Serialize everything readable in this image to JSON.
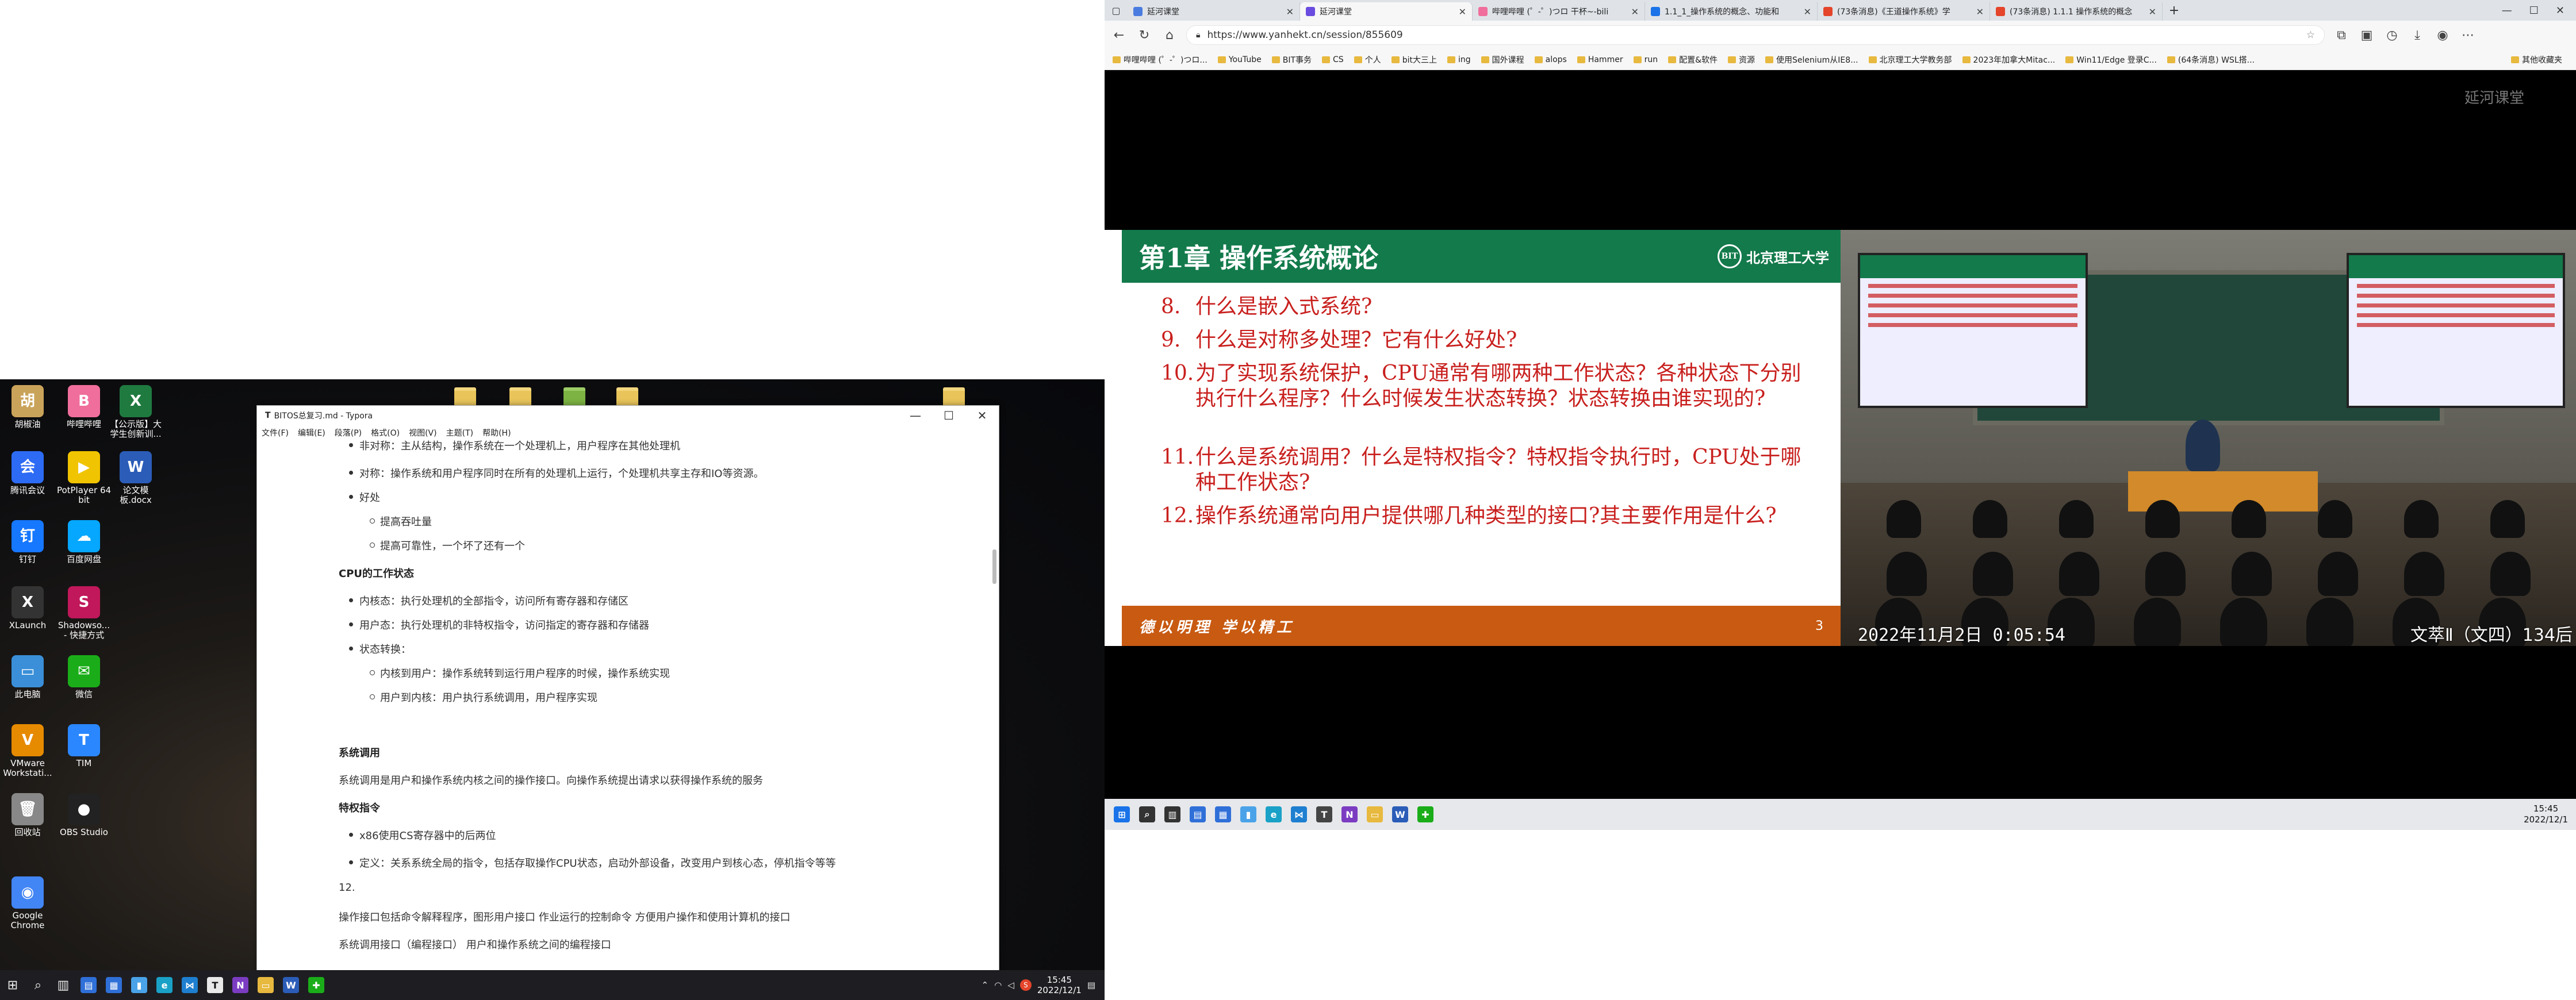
{
  "left_desktop": {
    "icons": [
      {
        "label": "胡椒油",
        "color": "#caa35a",
        "glyph": "胡"
      },
      {
        "label": "哔哩哔哩",
        "color": "#f06e9b",
        "glyph": "B"
      },
      {
        "label": "【公示版】大学生创新训...",
        "color": "#1f7a40",
        "glyph": "X"
      },
      {
        "label": "腾讯会议",
        "color": "#2d6bf5",
        "glyph": "会"
      },
      {
        "label": "PotPlayer 64 bit",
        "color": "#f0c400",
        "glyph": "▶"
      },
      {
        "label": "论文模板.docx",
        "color": "#2b5db8",
        "glyph": "W"
      },
      {
        "label": "钉钉",
        "color": "#1677ff",
        "glyph": "钉"
      },
      {
        "label": "百度网盘",
        "color": "#06a7ff",
        "glyph": "☁"
      },
      {
        "label": "XLaunch",
        "color": "#333",
        "glyph": "X"
      },
      {
        "label": "Shadowso... - 快捷方式",
        "color": "#c0185a",
        "glyph": "S"
      },
      {
        "label": "此电脑",
        "color": "#3a8fd8",
        "glyph": "▭"
      },
      {
        "label": "微信",
        "color": "#1aad19",
        "glyph": "✉"
      },
      {
        "label": "VMware Workstati...",
        "color": "#e68a00",
        "glyph": "V"
      },
      {
        "label": "TIM",
        "color": "#2b87ff",
        "glyph": "T"
      },
      {
        "label": "回收站",
        "color": "#888",
        "glyph": "🗑"
      },
      {
        "label": "OBS Studio",
        "color": "#222",
        "glyph": "●"
      },
      {
        "label": "Google Chrome",
        "color": "#4285f4",
        "glyph": "◉"
      }
    ]
  },
  "typora": {
    "title": "BITOS总复习.md - Typora",
    "menu": [
      "文件(F)",
      "编辑(E)",
      "段落(P)",
      "格式(O)",
      "视图(V)",
      "主题(T)",
      "帮助(H)"
    ],
    "lines": [
      {
        "text": "非对称：主从结构，操作系统在一个处理机上，用户程序在其他处理机",
        "style": "b1",
        "x": 1
      },
      {
        "text": "对称：操作系统和用户程序同时在所有的处理机上运行，个处理机共享主存和IO等资源。",
        "style": "b1",
        "x": 1
      },
      {
        "text": "好处",
        "style": "b1",
        "x": 1
      },
      {
        "text": "提高吞吐量",
        "style": "b2",
        "x": 2
      },
      {
        "text": "提高可靠性，一个坏了还有一个",
        "style": "b2",
        "x": 2
      },
      {
        "text": "CPU的工作状态",
        "style": "h",
        "x": 0
      },
      {
        "text": "内核态：执行处理机的全部指令，访问所有寄存器和存储区",
        "style": "b1",
        "x": 1
      },
      {
        "text": "用户态：执行处理机的非特权指令，访问指定的寄存器和存储器",
        "style": "b1",
        "x": 1
      },
      {
        "text": "状态转换：",
        "style": "b1",
        "x": 1
      },
      {
        "text": "内核到用户：操作系统转到运行用户程序的时候，操作系统实现",
        "style": "b2",
        "x": 2
      },
      {
        "text": "用户到内核：用户执行系统调用，用户程序实现",
        "style": "b2",
        "x": 2
      },
      {
        "text": "系统调用",
        "style": "h",
        "x": 0
      },
      {
        "text": "系统调用是用户和操作系统内核之间的操作接口。向操作系统提出请求以获得操作系统的服务",
        "style": "p",
        "x": 0
      },
      {
        "text": "特权指令",
        "style": "h",
        "x": 0
      },
      {
        "text": "x86使用CS寄存器中的后两位",
        "style": "b1",
        "x": 1
      },
      {
        "text": "定义：关系系统全局的指令，包括存取操作CPU状态，启动外部设备，改变用户到核心态，停机指令等等",
        "style": "b1",
        "x": 1
      },
      {
        "text": "12.",
        "style": "p",
        "x": 0
      },
      {
        "text": "操作接口包括命令解释程序，图形用户接口 作业运行的控制命令 方便用户操作和使用计算机的接口",
        "style": "p",
        "x": 0
      },
      {
        "text": "系统调用接口（编程接口）  用户和操作系统之间的编程接口",
        "style": "p",
        "x": 0
      }
    ]
  },
  "left_taskbar": {
    "apps": [
      {
        "name": "explorer",
        "color": "#2f6fd8",
        "glyph": "▤"
      },
      {
        "name": "calculator",
        "color": "#2f6fd8",
        "glyph": "▦"
      },
      {
        "name": "files",
        "color": "#4aa3e8",
        "glyph": "▮"
      },
      {
        "name": "edge",
        "color": "#1aa1c7",
        "glyph": "e"
      },
      {
        "name": "vscode",
        "color": "#1e7fd0",
        "glyph": "⋈"
      },
      {
        "name": "typora",
        "color": "#e9e9e9",
        "glyph": "T"
      },
      {
        "name": "onenote",
        "color": "#7b3cc2",
        "glyph": "N"
      },
      {
        "name": "folder",
        "color": "#e8b93f",
        "glyph": "▭"
      },
      {
        "name": "word",
        "color": "#2b5db8",
        "glyph": "W"
      },
      {
        "name": "wechat-dev",
        "color": "#1aad19",
        "glyph": "✚"
      }
    ],
    "time": "15:45",
    "date": "2022/12/1"
  },
  "browser": {
    "tabs": [
      {
        "label": "延河课堂",
        "color": "#4a7ce0"
      },
      {
        "label": "延河课堂",
        "color": "#6a4ce0",
        "active": true
      },
      {
        "label": "哔哩哔哩 (゜-゜)つロ 干杯~-bili",
        "color": "#f06e9b"
      },
      {
        "label": "1.1_1_操作系统的概念、功能和",
        "color": "#1a73e8"
      },
      {
        "label": "(73条消息)《王道操作系统》学",
        "color": "#e4452b"
      },
      {
        "label": "(73条消息) 1.1.1 操作系统的概念",
        "color": "#e4452b"
      }
    ],
    "url": "https://www.yanhekt.cn/session/855609",
    "bookmarks": [
      "哔哩哔哩 (゜-゜)つロ...",
      "YouTube",
      "BIT事务",
      "CS",
      "个人",
      "bit大三上",
      "ing",
      "国外课程",
      "alops",
      "Hammer",
      "run",
      "配置&软件",
      "资源",
      "使用Selenium从IE8...",
      "北京理工大学教务部",
      "2023年加拿大Mitac...",
      "Win11/Edge 登录C...",
      "(64条消息) WSL搭..."
    ],
    "bookmark_more": "其他收藏夹",
    "brand": "延河课堂"
  },
  "slide": {
    "title": "第1章 操作系统概论",
    "school": "北京理工大学",
    "questions": [
      {
        "num": "8.",
        "text": "什么是嵌入式系统?"
      },
      {
        "num": "9.",
        "text": "什么是对称多处理？它有什么好处?"
      },
      {
        "num": "10.",
        "text": "为了实现系统保护，CPU通常有哪两种工作状态？各种状态下分别执行什么程序？什么时候发生状态转换？状态转换由谁实现的?"
      },
      {
        "num": "11.",
        "text": "什么是系统调用？什么是特权指令？特权指令执行时，CPU处于哪种工作状态?"
      },
      {
        "num": "12.",
        "text": "操作系统通常向用户提供哪几种类型的接口?其主要作用是什么?"
      }
    ],
    "motto": "德以明理 学以精工",
    "page": "3"
  },
  "camera": {
    "timestamp": "2022年11月2日 0:05:54",
    "room": "文萃Ⅱ（文四）134后"
  },
  "right_taskbar": {
    "apps": [
      {
        "name": "start",
        "color": "#1a73e8",
        "glyph": "⊞"
      },
      {
        "name": "search",
        "color": "#333",
        "glyph": "⌕"
      },
      {
        "name": "taskview",
        "color": "#333",
        "glyph": "▥"
      },
      {
        "name": "explorer",
        "color": "#2f6fd8",
        "glyph": "▤"
      },
      {
        "name": "calculator",
        "color": "#2f6fd8",
        "glyph": "▦"
      },
      {
        "name": "files",
        "color": "#4aa3e8",
        "glyph": "▮"
      },
      {
        "name": "edge",
        "color": "#1aa1c7",
        "glyph": "e"
      },
      {
        "name": "vscode",
        "color": "#1e7fd0",
        "glyph": "⋈"
      },
      {
        "name": "typora",
        "color": "#444",
        "glyph": "T"
      },
      {
        "name": "onenote",
        "color": "#7b3cc2",
        "glyph": "N"
      },
      {
        "name": "folder",
        "color": "#e8b93f",
        "glyph": "▭"
      },
      {
        "name": "word",
        "color": "#2b5db8",
        "glyph": "W"
      },
      {
        "name": "wechat-dev",
        "color": "#1aad19",
        "glyph": "✚"
      }
    ],
    "time": "15:45",
    "date": "2022/12/1"
  }
}
